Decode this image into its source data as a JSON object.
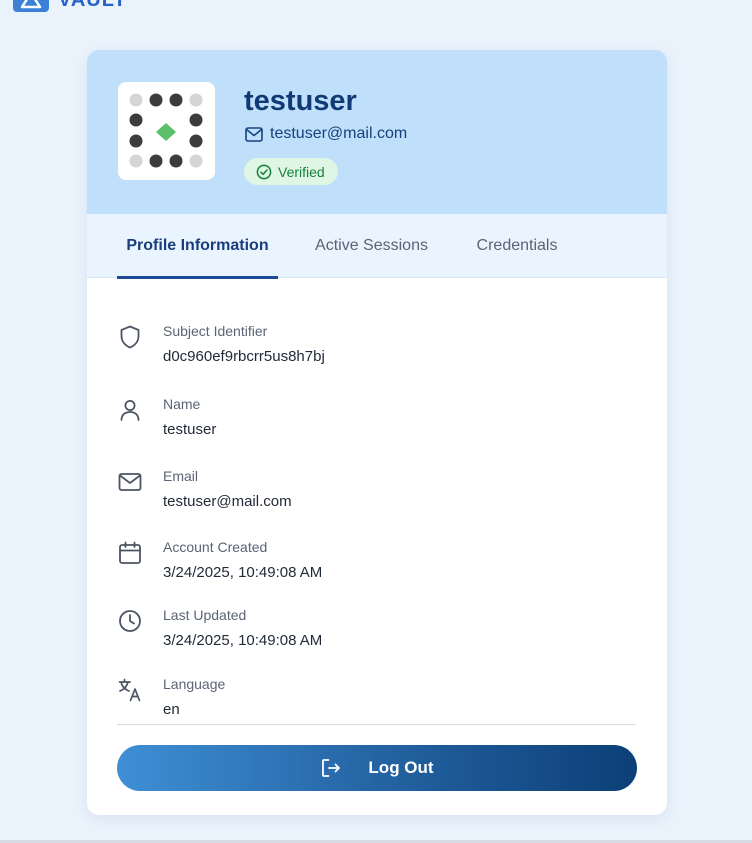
{
  "brand": {
    "name": "VAULT",
    "logo_icon": "vault-logo-icon",
    "color": "#2563c9"
  },
  "profile": {
    "username": "testuser",
    "email": "testuser@mail.com",
    "email_icon": "mail-icon",
    "verified_label": "Verified",
    "verified_icon": "check-circle-icon",
    "avatar_icon": "identicon-avatar"
  },
  "tabs": [
    {
      "label": "Profile Information",
      "active": true
    },
    {
      "label": "Active Sessions",
      "active": false
    },
    {
      "label": "Credentials",
      "active": false
    }
  ],
  "fields": [
    {
      "icon": "shield-icon",
      "label": "Subject Identifier",
      "value": "d0c960ef9rbcrr5us8h7bj"
    },
    {
      "icon": "user-icon",
      "label": "Name",
      "value": "testuser"
    },
    {
      "icon": "mail-icon",
      "label": "Email",
      "value": "testuser@mail.com"
    },
    {
      "icon": "calendar-icon",
      "label": "Account Created",
      "value": "3/24/2025, 10:49:08 AM"
    },
    {
      "icon": "clock-icon",
      "label": "Last Updated",
      "value": "3/24/2025, 10:49:08 AM"
    },
    {
      "icon": "translate-icon",
      "label": "Language",
      "value": "en"
    }
  ],
  "logout": {
    "label": "Log Out",
    "icon": "logout-icon"
  },
  "colors": {
    "header_bg": "#bfdffa",
    "tabs_bg": "#eaf4fe",
    "accent": "#1e4a96",
    "verified_bg": "#dff6e5",
    "verified_text": "#15803d",
    "identicon_accent": "#5cbf6a"
  }
}
